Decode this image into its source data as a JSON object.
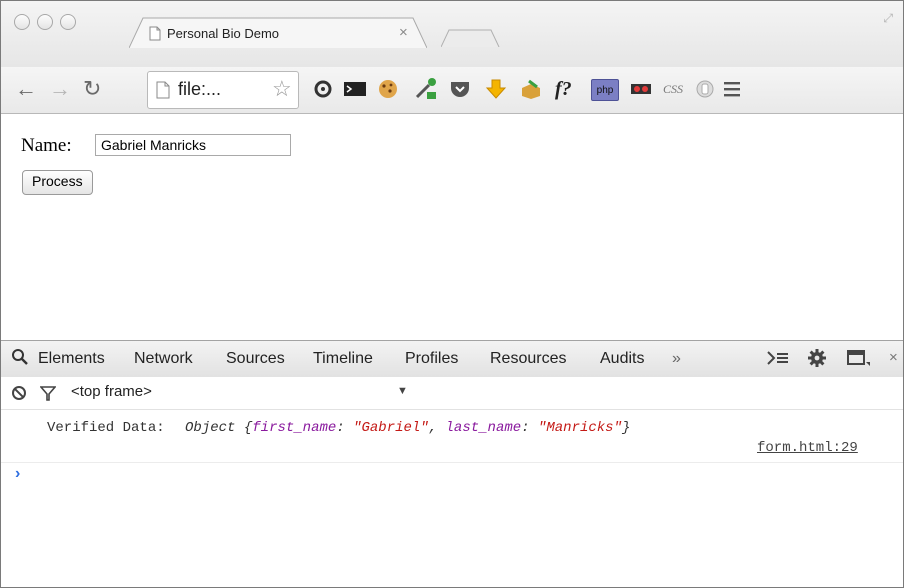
{
  "browser": {
    "tab_title": "Personal Bio Demo",
    "tab_close": "×",
    "url": "file:...",
    "extensions": {
      "f_label": "f?",
      "php_label": "php",
      "css_label": "CSS"
    }
  },
  "page": {
    "name_label": "Name:",
    "name_value": "Gabriel Manricks",
    "process_label": "Process"
  },
  "devtools": {
    "tabs": [
      "Elements",
      "Network",
      "Sources",
      "Timeline",
      "Profiles",
      "Resources",
      "Audits"
    ],
    "more": "»",
    "frame_select": "<top frame>",
    "frame_dropdown": "▼",
    "console": {
      "prefix": "Verified Data:",
      "object_word": "Object",
      "brace_open": "{",
      "key1": "first_name",
      "colon1": ": ",
      "value1": "\"Gabriel\"",
      "comma": ", ",
      "key2": "last_name",
      "colon2": ": ",
      "value2": "\"Manricks\"",
      "brace_close": "}",
      "source": "form.html:29",
      "prompt": "›"
    }
  },
  "colors": {
    "console_key": "#8a1a9e",
    "console_string": "#c41a16",
    "prompt": "#2d6de0"
  }
}
